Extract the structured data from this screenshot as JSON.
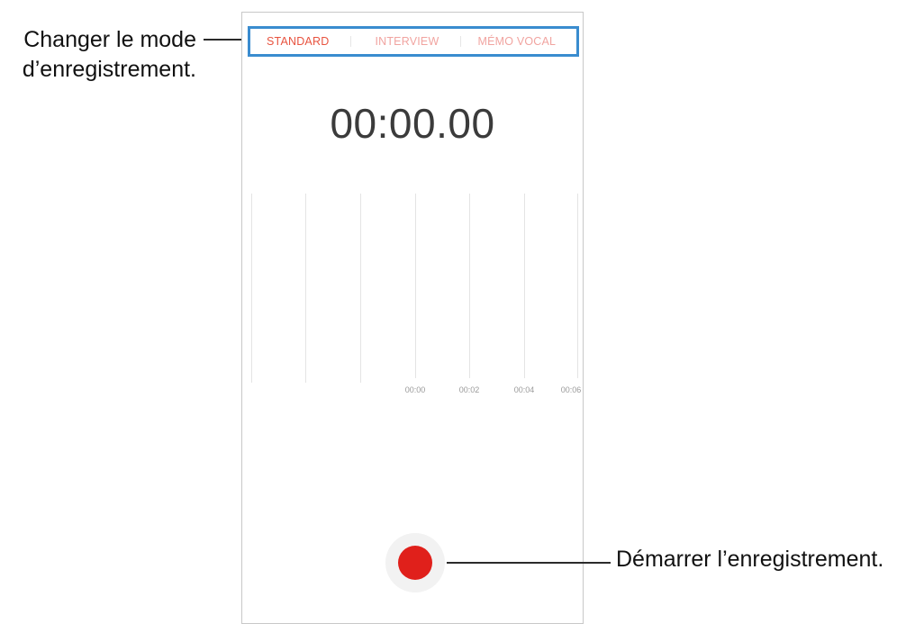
{
  "callouts": {
    "mode_change_line1": "Changer le mode",
    "mode_change_line2": "d’enregistrement.",
    "start_recording": "Démarrer l’enregistrement."
  },
  "recorder": {
    "modes": [
      "STANDARD",
      "INTERVIEW",
      "MÉMO VOCAL"
    ],
    "active_mode": "STANDARD",
    "timer": "00:00.00",
    "timeline_ticks": [
      "00:00",
      "00:02",
      "00:04",
      "00:06"
    ],
    "record_button_icon": "record-dot-icon"
  },
  "colors": {
    "active_tab": "#e8533f",
    "inactive_tab": "#f1a4a0",
    "highlight_box": "#3a8ccf",
    "record": "#e0201b"
  }
}
